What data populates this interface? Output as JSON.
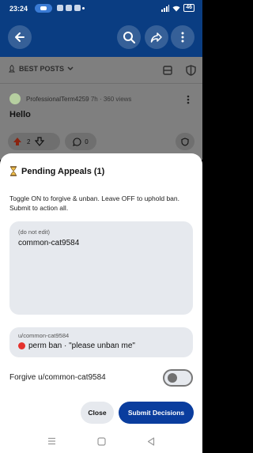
{
  "status_bar": {
    "time": "23:24",
    "battery": "46"
  },
  "feed": {
    "sort_label": "BEST POSTS",
    "author": "ProfessionalTerm4259",
    "age_views": "7h · 360 views",
    "post_title": "Hello",
    "vote_count": "2",
    "comment_count": "0"
  },
  "sheet": {
    "title": "Pending Appeals (1)",
    "description": "Toggle ON to forgive & unban. Leave OFF to uphold ban. Submit to action all.",
    "text_hint": "(do not edit)",
    "text_value": "common-cat9584",
    "appeal_user": "u/common-cat9584",
    "appeal_line": "perm ban · \"please unban me\"",
    "toggle_label": "Forgive u/common-cat9584",
    "toggle_on": false,
    "close_label": "Close",
    "submit_label": "Submit Decisions"
  },
  "colors": {
    "header": "#0a3d82",
    "primary_button": "#0a3d9e",
    "ban_dot": "#e5322d"
  },
  "icons": [
    "back-arrow-icon",
    "search-icon",
    "share-icon",
    "more-vertical-icon",
    "upvote-icon",
    "downvote-icon",
    "comment-icon",
    "award-icon",
    "hourglass-icon"
  ]
}
